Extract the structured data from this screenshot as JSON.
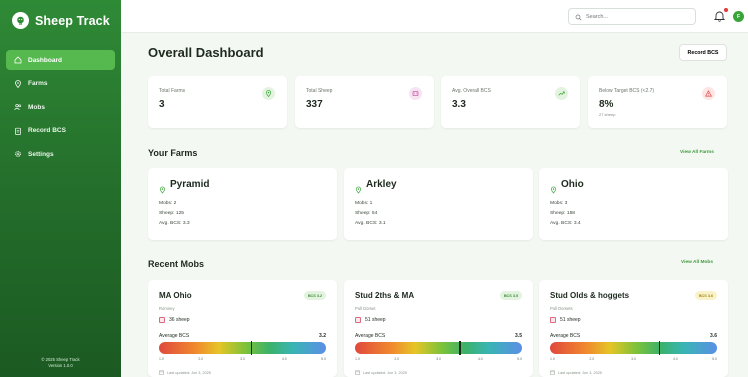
{
  "app": {
    "title": "Sheep Track",
    "footer_line1": "© 2025 Sheep Track",
    "footer_line2": "Version 1.0.0"
  },
  "sidebar": {
    "items": [
      {
        "label": "Dashboard",
        "icon": "home-icon",
        "active": true
      },
      {
        "label": "Farms",
        "icon": "map-pin-icon",
        "active": false
      },
      {
        "label": "Mobs",
        "icon": "users-icon",
        "active": false
      },
      {
        "label": "Record BCS",
        "icon": "clipboard-icon",
        "active": false
      },
      {
        "label": "Settings",
        "icon": "gear-icon",
        "active": false
      }
    ]
  },
  "header": {
    "search_placeholder": "Search...",
    "avatar_initial": "F",
    "notification_dot": true
  },
  "main": {
    "title": "Overall Dashboard",
    "record_button": "Record BCS",
    "stats": [
      {
        "label": "Total Farms",
        "value": "3",
        "sub": "",
        "icon": "map-pin-icon",
        "color": "#3aa43a"
      },
      {
        "label": "Total Sheep",
        "value": "337",
        "sub": "",
        "icon": "sheep-icon",
        "color": "#c2489e"
      },
      {
        "label": "Avg. Overall BCS",
        "value": "3.3",
        "sub": "",
        "icon": "trend-up-icon",
        "color": "#3aa43a"
      },
      {
        "label": "Below Target BCS (<2.7)",
        "value": "8%",
        "sub": "27 sheep",
        "icon": "warning-icon",
        "color": "#e04848"
      }
    ],
    "farms_section": {
      "title": "Your Farms",
      "link": "View All Farms"
    },
    "farms": [
      {
        "name": "Pyramid",
        "mobs": "Mobs: 2",
        "sheep": "Sheep: 125",
        "avg": "Avg. BCS: 3.3"
      },
      {
        "name": "Arkley",
        "mobs": "Mobs: 1",
        "sheep": "Sheep: 54",
        "avg": "Avg. BCS: 3.1"
      },
      {
        "name": "Ohio",
        "mobs": "Mobs: 3",
        "sheep": "Sheep: 158",
        "avg": "Avg. BCS: 3.4"
      }
    ],
    "mobs_section": {
      "title": "Recent Mobs",
      "link": "View All Mobs"
    },
    "mobs": [
      {
        "name": "MA Ohio",
        "badge": "BCS 3.2",
        "badge_color": "#e3f3df",
        "badge_text": "#3b8f3b",
        "breed": "Romney",
        "sheep": "36 sheep",
        "avg_label": "Average BCS",
        "avg": "3.2",
        "bcs": 3.2,
        "updated": "Last updated: Jun 3, 2025"
      },
      {
        "name": "Stud 2ths & MA",
        "badge": "BCS 3.5",
        "badge_color": "#e3f3df",
        "badge_text": "#3b8f3b",
        "breed": "Poll Dorset",
        "sheep": "51 sheep",
        "avg_label": "Average BCS",
        "avg": "3.5",
        "bcs": 3.5,
        "updated": "Last updated: Jun 3, 2025"
      },
      {
        "name": "Stud Olds & hoggets",
        "badge": "BCS 3.6",
        "badge_color": "#fbf3c8",
        "badge_text": "#a3861a",
        "breed": "Poll Dorsets",
        "sheep": "51 sheep",
        "avg_label": "Average BCS",
        "avg": "3.6",
        "bcs": 3.6,
        "updated": "Last updated: Jun 3, 2025"
      }
    ],
    "bcs_scale": {
      "min": 1.0,
      "max": 5.0,
      "ticks": [
        "1.0",
        "2.0",
        "3.0",
        "4.0",
        "5.0"
      ]
    }
  }
}
